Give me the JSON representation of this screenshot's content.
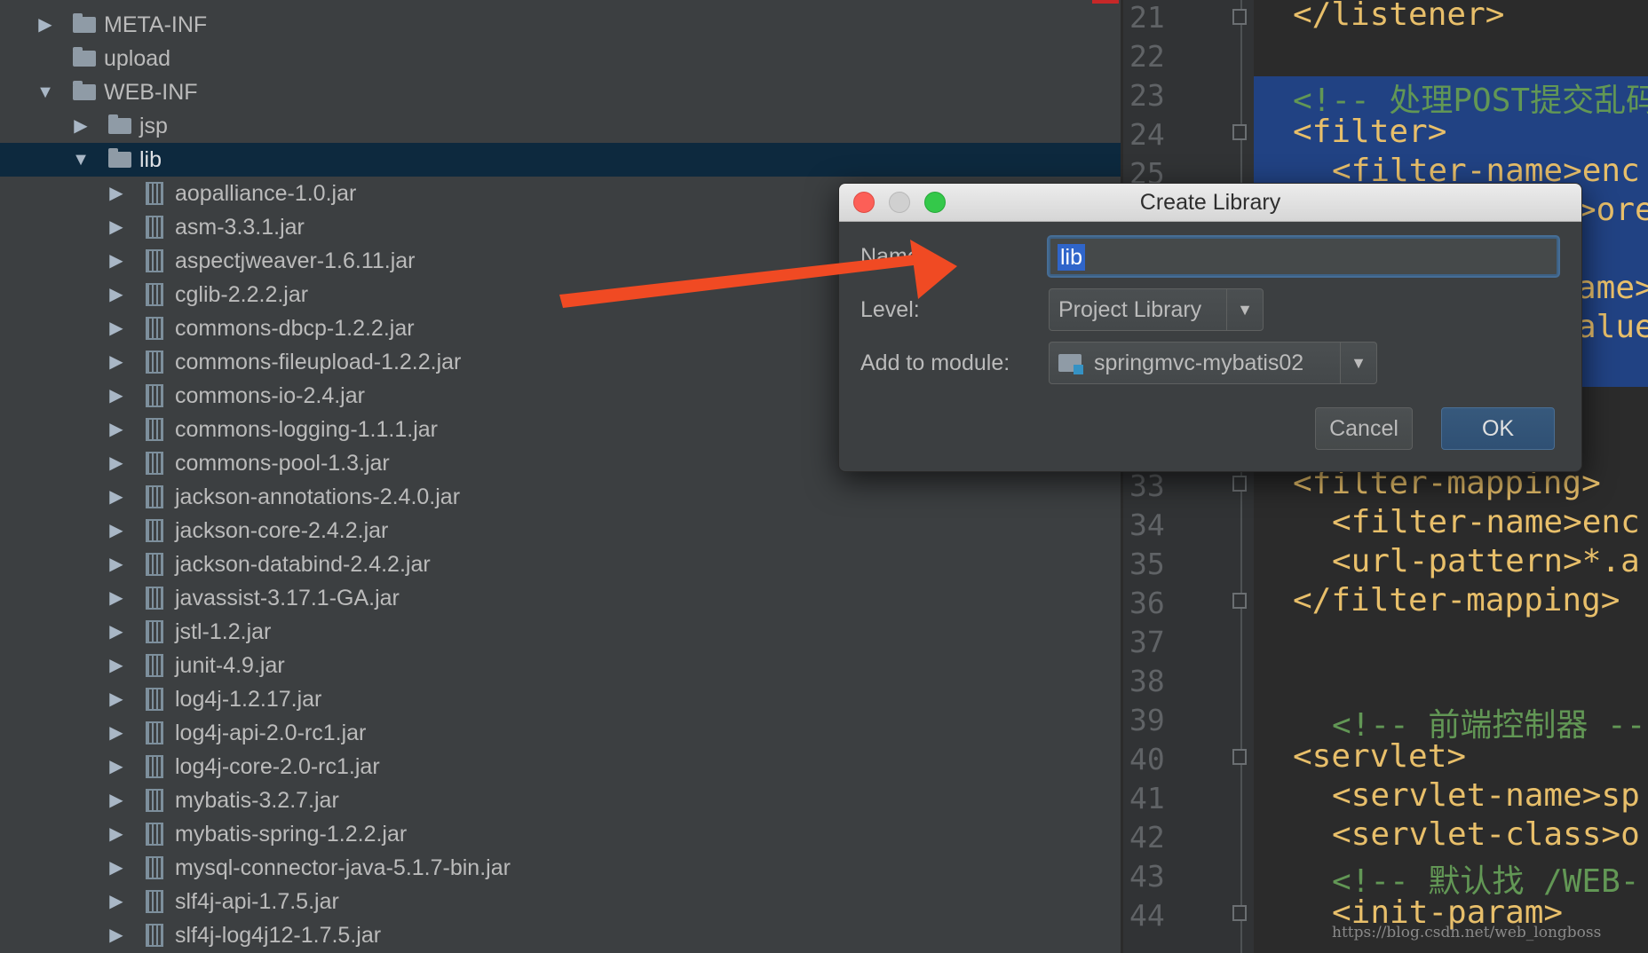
{
  "tree": {
    "rows": [
      {
        "label": "META-INF",
        "type": "folder",
        "expand": "collapsed",
        "indent": 0
      },
      {
        "label": "upload",
        "type": "folder",
        "expand": "none",
        "indent": 0
      },
      {
        "label": "WEB-INF",
        "type": "folder",
        "expand": "expanded",
        "indent": 0
      },
      {
        "label": "jsp",
        "type": "folder",
        "expand": "collapsed",
        "indent": 1
      },
      {
        "label": "lib",
        "type": "folder",
        "expand": "expanded",
        "indent": 1,
        "selected": true
      },
      {
        "label": "aopalliance-1.0.jar",
        "type": "jar",
        "expand": "collapsed",
        "indent": 2
      },
      {
        "label": "asm-3.3.1.jar",
        "type": "jar",
        "expand": "collapsed",
        "indent": 2
      },
      {
        "label": "aspectjweaver-1.6.11.jar",
        "type": "jar",
        "expand": "collapsed",
        "indent": 2
      },
      {
        "label": "cglib-2.2.2.jar",
        "type": "jar",
        "expand": "collapsed",
        "indent": 2
      },
      {
        "label": "commons-dbcp-1.2.2.jar",
        "type": "jar",
        "expand": "collapsed",
        "indent": 2
      },
      {
        "label": "commons-fileupload-1.2.2.jar",
        "type": "jar",
        "expand": "collapsed",
        "indent": 2
      },
      {
        "label": "commons-io-2.4.jar",
        "type": "jar",
        "expand": "collapsed",
        "indent": 2
      },
      {
        "label": "commons-logging-1.1.1.jar",
        "type": "jar",
        "expand": "collapsed",
        "indent": 2
      },
      {
        "label": "commons-pool-1.3.jar",
        "type": "jar",
        "expand": "collapsed",
        "indent": 2
      },
      {
        "label": "jackson-annotations-2.4.0.jar",
        "type": "jar",
        "expand": "collapsed",
        "indent": 2
      },
      {
        "label": "jackson-core-2.4.2.jar",
        "type": "jar",
        "expand": "collapsed",
        "indent": 2
      },
      {
        "label": "jackson-databind-2.4.2.jar",
        "type": "jar",
        "expand": "collapsed",
        "indent": 2
      },
      {
        "label": "javassist-3.17.1-GA.jar",
        "type": "jar",
        "expand": "collapsed",
        "indent": 2
      },
      {
        "label": "jstl-1.2.jar",
        "type": "jar",
        "expand": "collapsed",
        "indent": 2
      },
      {
        "label": "junit-4.9.jar",
        "type": "jar",
        "expand": "collapsed",
        "indent": 2
      },
      {
        "label": "log4j-1.2.17.jar",
        "type": "jar",
        "expand": "collapsed",
        "indent": 2
      },
      {
        "label": "log4j-api-2.0-rc1.jar",
        "type": "jar",
        "expand": "collapsed",
        "indent": 2
      },
      {
        "label": "log4j-core-2.0-rc1.jar",
        "type": "jar",
        "expand": "collapsed",
        "indent": 2
      },
      {
        "label": "mybatis-3.2.7.jar",
        "type": "jar",
        "expand": "collapsed",
        "indent": 2
      },
      {
        "label": "mybatis-spring-1.2.2.jar",
        "type": "jar",
        "expand": "collapsed",
        "indent": 2
      },
      {
        "label": "mysql-connector-java-5.1.7-bin.jar",
        "type": "jar",
        "expand": "collapsed",
        "indent": 2
      },
      {
        "label": "slf4j-api-1.7.5.jar",
        "type": "jar",
        "expand": "collapsed",
        "indent": 2
      },
      {
        "label": "slf4j-log4j12-1.7.5.jar",
        "type": "jar",
        "expand": "collapsed",
        "indent": 2
      }
    ]
  },
  "editor": {
    "line_numbers": [
      "21",
      "22",
      "23",
      "24",
      "25",
      "33",
      "34",
      "35",
      "36",
      "37",
      "38",
      "39",
      "40",
      "41",
      "42",
      "43",
      "44"
    ],
    "lines": [
      {
        "n": "21",
        "text": "</listener>",
        "kind": "tag",
        "indent": 0
      },
      {
        "n": "23",
        "text": "<!-- 处理POST提交乱码",
        "kind": "cmt",
        "indent": 0
      },
      {
        "n": "24",
        "text": "<filter>",
        "kind": "tag",
        "indent": 0
      },
      {
        "n": "25",
        "text": "<filter-name>enc",
        "kind": "tag",
        "indent": 1
      },
      {
        "n": "26",
        "text": ">ore",
        "kind": "tag",
        "indent": 5
      },
      {
        "n": "27",
        "text": "ame>e",
        "kind": "tag",
        "indent": 5
      },
      {
        "n": "28",
        "text": "alue>",
        "kind": "tag",
        "indent": 5
      },
      {
        "n": "33",
        "text": "<filter-mapping>",
        "kind": "tag",
        "indent": 0
      },
      {
        "n": "34",
        "text": "<filter-name>enc",
        "kind": "tag",
        "indent": 1
      },
      {
        "n": "35",
        "text": "<url-pattern>*.a",
        "kind": "tag",
        "indent": 1
      },
      {
        "n": "36",
        "text": "</filter-mapping>",
        "kind": "tag",
        "indent": 0
      },
      {
        "n": "39",
        "text": "<!-- 前端控制器 --",
        "kind": "cmt",
        "indent": 1
      },
      {
        "n": "40",
        "text": "<servlet>",
        "kind": "tag",
        "indent": 0
      },
      {
        "n": "41",
        "text": "<servlet-name>sp",
        "kind": "tag",
        "indent": 1
      },
      {
        "n": "42",
        "text": "<servlet-class>o",
        "kind": "tag",
        "indent": 1
      },
      {
        "n": "43",
        "text": "<!-- 默认找 /WEB-",
        "kind": "cmt",
        "indent": 1
      },
      {
        "n": "44",
        "text": "<init-param>",
        "kind": "tag",
        "indent": 1
      }
    ],
    "watermark": "https://blog.csdn.net/web_longboss"
  },
  "dialog": {
    "title": "Create Library",
    "name_label": "Name:",
    "name_value": "lib",
    "level_label": "Level:",
    "level_value": "Project Library",
    "module_label": "Add to module:",
    "module_value": "springmvc-mybatis02",
    "cancel_label": "Cancel",
    "ok_label": "OK"
  },
  "colors": {
    "tree_bg": "#3c3f41",
    "selection": "#0d293e",
    "editor_bg": "#2b2b2b",
    "tag": "#e8bf6a",
    "comment": "#629755",
    "annotation_arrow": "#f04a23"
  },
  "icons": [
    "folder-icon",
    "jar-icon",
    "expand-arrow-icon",
    "collapse-arrow-icon",
    "fold-marker-icon",
    "module-icon",
    "dropdown-arrow-icon"
  ]
}
